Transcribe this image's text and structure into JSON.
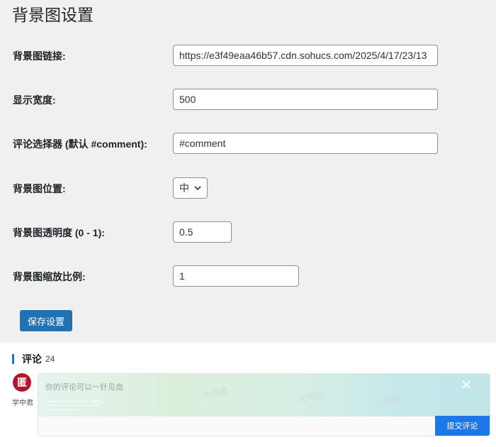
{
  "page": {
    "title": "背景图设置"
  },
  "fields": {
    "bg_url": {
      "label": "背景图链接:",
      "value": "https://e3f49eaa46b57.cdn.sohucs.com/2025/4/17/23/13"
    },
    "display_width": {
      "label": "显示宽度:",
      "value": "500"
    },
    "comment_selector": {
      "label": "评论选择器 (默认 #comment):",
      "value": "#comment"
    },
    "bg_position": {
      "label": "背景图位置:",
      "selected": "中",
      "icon": "chevron-down-icon"
    },
    "bg_opacity": {
      "label": "背景图透明度 (0 - 1):",
      "value": "0.5"
    },
    "bg_scale": {
      "label": "背景图缩放比例:",
      "value": "1"
    }
  },
  "actions": {
    "save_label": "保存设置"
  },
  "comments": {
    "title": "评论",
    "count": "24",
    "avatar_glyph": "匿",
    "user_name": "学中君",
    "placeholder": "你的评论可以一针见血",
    "submit_label": "提交评论",
    "accent_color": "#1b78e6"
  },
  "colors": {
    "primary_button": "#2271b1",
    "panel_bg": "#f0f0f1",
    "avatar_bg": "#b5152b"
  }
}
